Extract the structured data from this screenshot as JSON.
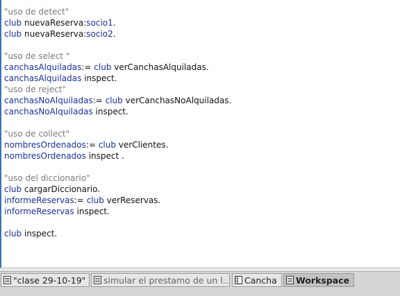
{
  "code_lines": [
    {
      "parts": [
        {
          "t": "\"uso de detect\"",
          "c": "cmt"
        }
      ]
    },
    {
      "parts": [
        {
          "t": "club",
          "c": "blue"
        },
        {
          "t": " nuevaReserva:",
          "c": ""
        },
        {
          "t": "socio1",
          "c": "blue"
        },
        {
          "t": ".",
          "c": ""
        }
      ]
    },
    {
      "parts": [
        {
          "t": "club",
          "c": "blue"
        },
        {
          "t": " nuevaReserva:",
          "c": ""
        },
        {
          "t": "socio2",
          "c": "blue"
        },
        {
          "t": ".",
          "c": ""
        }
      ]
    },
    {
      "parts": []
    },
    {
      "parts": [
        {
          "t": "\"uso de select \"",
          "c": "cmt"
        }
      ]
    },
    {
      "parts": [
        {
          "t": "canchasAlquiladas",
          "c": "blue"
        },
        {
          "t": ":= ",
          "c": ""
        },
        {
          "t": "club",
          "c": "blue"
        },
        {
          "t": " verCanchasAlquiladas.",
          "c": ""
        }
      ]
    },
    {
      "parts": [
        {
          "t": "canchasAlquiladas",
          "c": "blue"
        },
        {
          "t": " inspect.",
          "c": ""
        }
      ]
    },
    {
      "parts": [
        {
          "t": "\"uso de reject\"",
          "c": "cmt"
        }
      ]
    },
    {
      "parts": [
        {
          "t": "canchasNoAlquiladas",
          "c": "blue"
        },
        {
          "t": ":= ",
          "c": ""
        },
        {
          "t": "club",
          "c": "blue"
        },
        {
          "t": " verCanchasNoAlquiladas.",
          "c": ""
        }
      ]
    },
    {
      "parts": [
        {
          "t": "canchasNoAlquiladas",
          "c": "blue"
        },
        {
          "t": " inspect.",
          "c": ""
        }
      ]
    },
    {
      "parts": []
    },
    {
      "parts": [
        {
          "t": "\"uso de collect\"",
          "c": "cmt"
        }
      ]
    },
    {
      "parts": [
        {
          "t": "nombresOrdenados",
          "c": "blue"
        },
        {
          "t": ":= ",
          "c": ""
        },
        {
          "t": "club",
          "c": "blue"
        },
        {
          "t": " verClientes.",
          "c": ""
        }
      ]
    },
    {
      "parts": [
        {
          "t": "nombresOrdenados",
          "c": "blue"
        },
        {
          "t": " inspect .",
          "c": ""
        }
      ]
    },
    {
      "parts": []
    },
    {
      "parts": [
        {
          "t": "\"uso del diccionario\"",
          "c": "cmt"
        }
      ]
    },
    {
      "parts": [
        {
          "t": "club",
          "c": "blue"
        },
        {
          "t": " cargarDiccionario.",
          "c": ""
        }
      ]
    },
    {
      "parts": [
        {
          "t": "informeReservas",
          "c": "blue"
        },
        {
          "t": ":= ",
          "c": ""
        },
        {
          "t": "club",
          "c": "blue"
        },
        {
          "t": " verReservas.",
          "c": ""
        }
      ]
    },
    {
      "parts": [
        {
          "t": "informeReservas",
          "c": "blue"
        },
        {
          "t": " inspect.",
          "c": ""
        }
      ]
    },
    {
      "parts": []
    },
    {
      "parts": [
        {
          "t": "club",
          "c": "blue"
        },
        {
          "t": " inspect.",
          "c": ""
        }
      ]
    }
  ],
  "taskbar": {
    "items": [
      {
        "label": "\"clase 29-10-19\"",
        "icon": "workspace-icon",
        "active": false,
        "dim": false
      },
      {
        "label": "simular el prestamo de un l...",
        "icon": "workspace-icon",
        "active": false,
        "dim": true
      },
      {
        "label": "Cancha",
        "icon": "inspector-icon",
        "active": false,
        "dim": false
      },
      {
        "label": "Workspace",
        "icon": "workspace-icon",
        "active": true,
        "dim": false
      }
    ]
  },
  "colors": {
    "accent": "#3a73b5",
    "keyword": "#1a2f9e",
    "comment": "#7a7a7a"
  }
}
